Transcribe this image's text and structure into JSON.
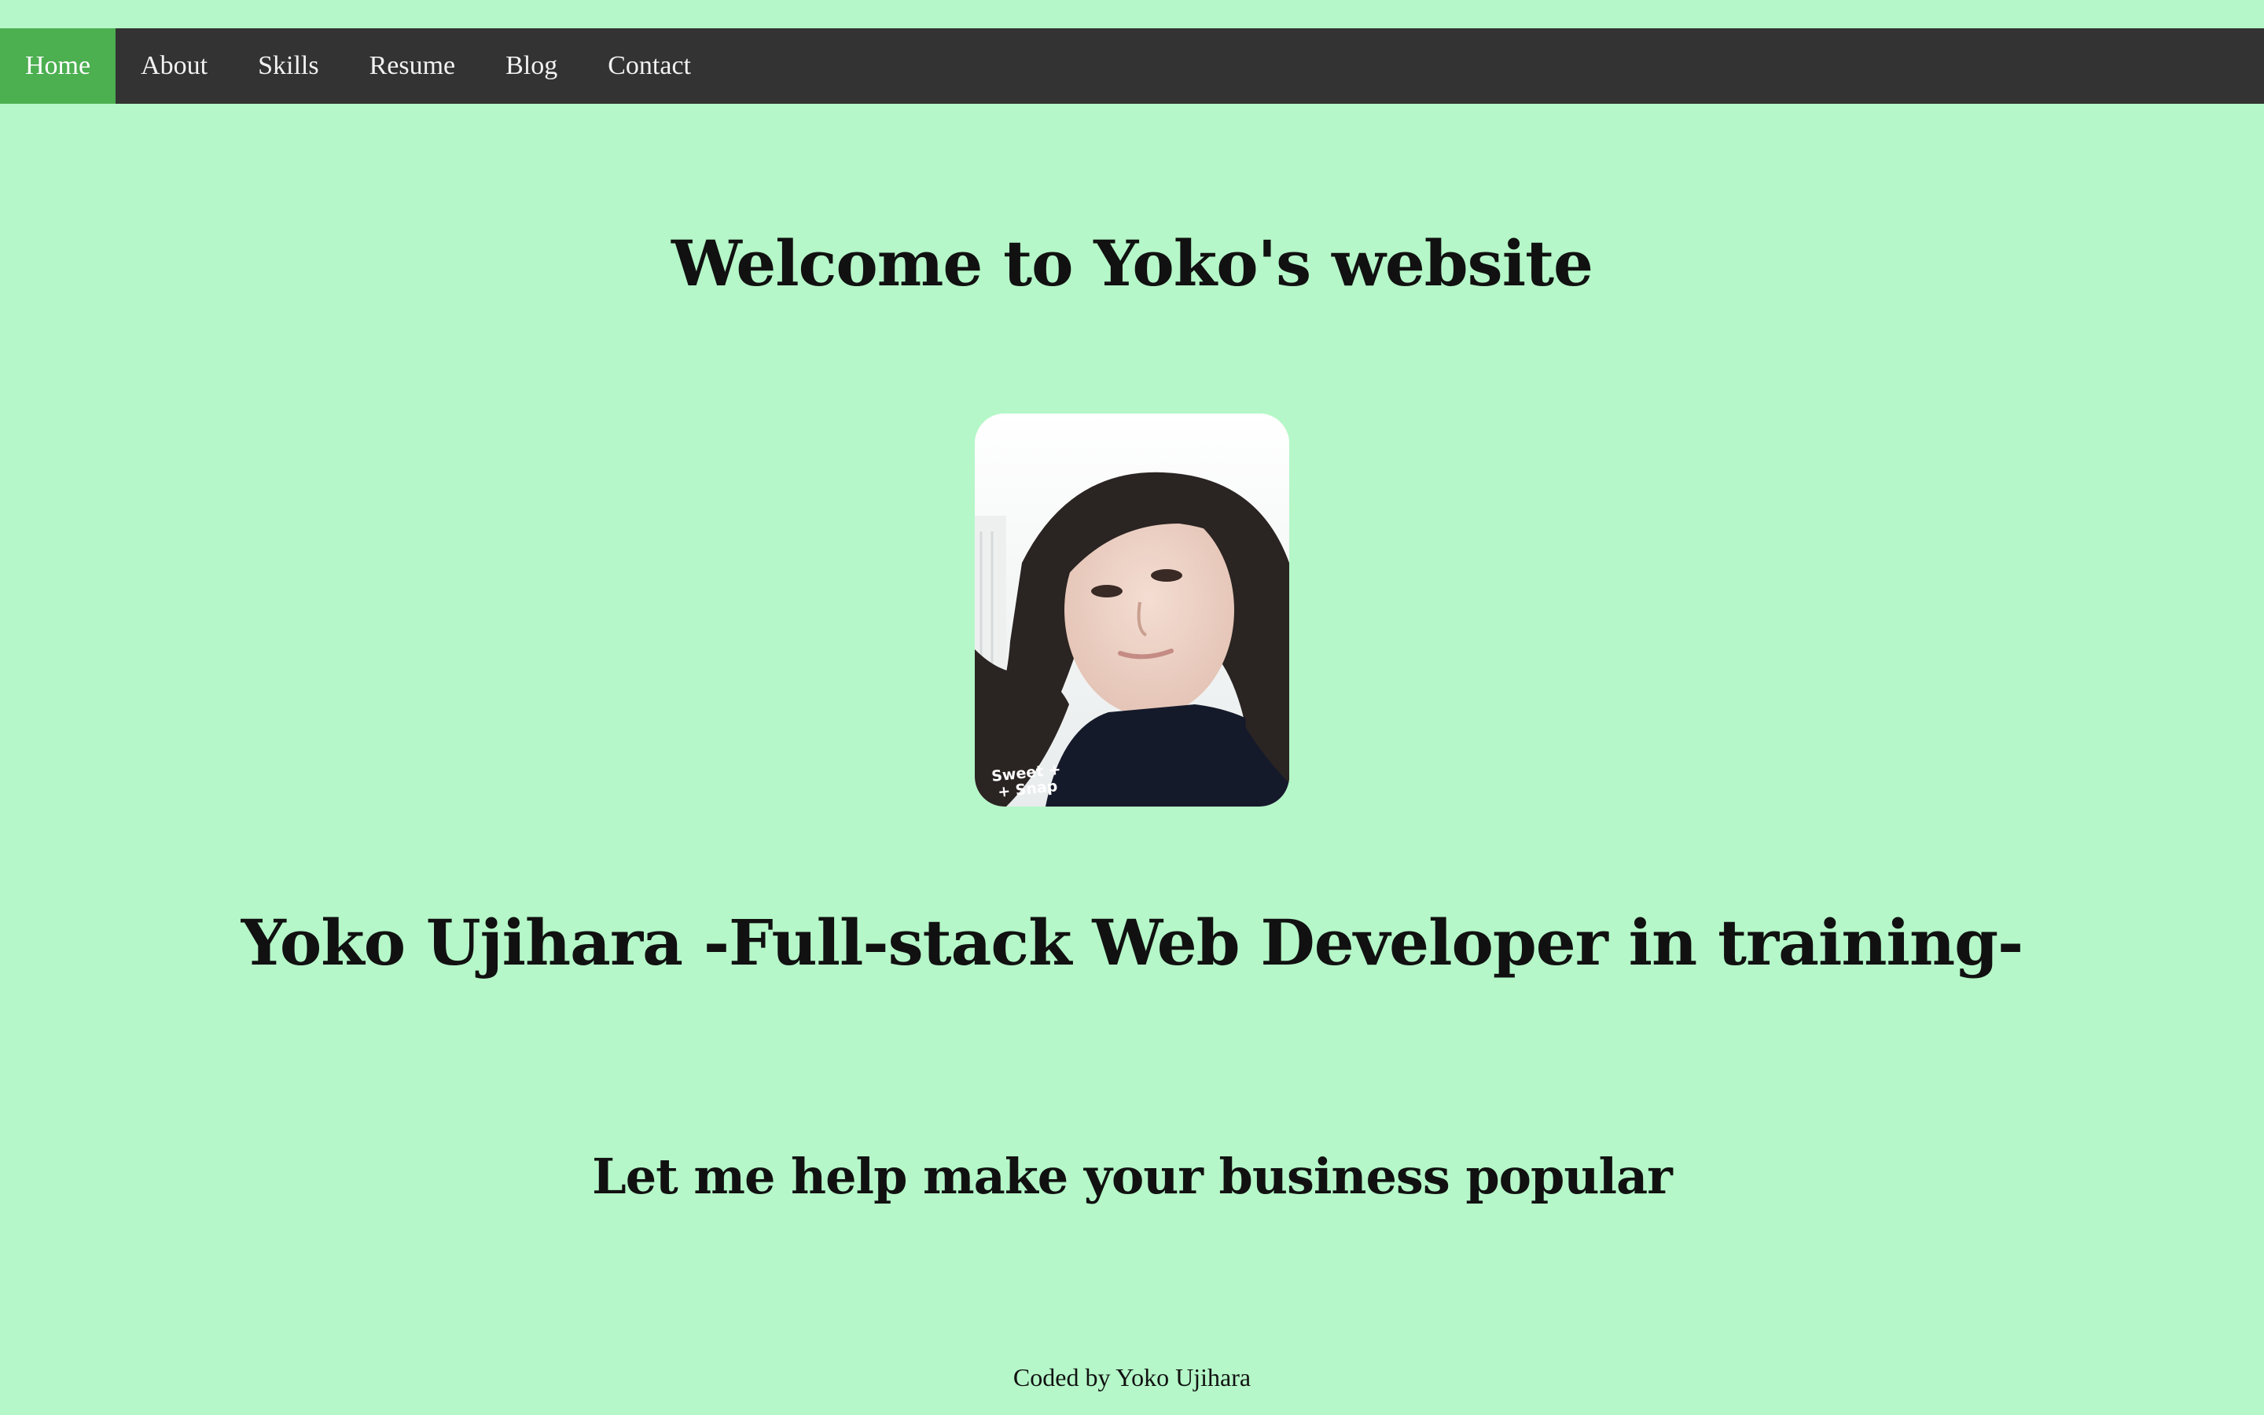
{
  "colors": {
    "background": "#b5f7c8",
    "navbar": "#333333",
    "nav_active": "#4caf50",
    "nav_text": "#f2f2f2"
  },
  "nav": {
    "items": [
      {
        "label": "Home",
        "active": true
      },
      {
        "label": "About",
        "active": false
      },
      {
        "label": "Skills",
        "active": false
      },
      {
        "label": "Resume",
        "active": false
      },
      {
        "label": "Blog",
        "active": false
      },
      {
        "label": "Contact",
        "active": false
      }
    ]
  },
  "hero": {
    "welcome": "Welcome to Yoko's website",
    "photo_caption_line1": "Sweet +",
    "photo_caption_line2": "+ Snap",
    "name_title": "Yoko Ujihara -Full-stack Web Developer in training-",
    "tagline": "Let me help make your business popular"
  },
  "footer": {
    "text": "Coded by Yoko Ujihara"
  }
}
